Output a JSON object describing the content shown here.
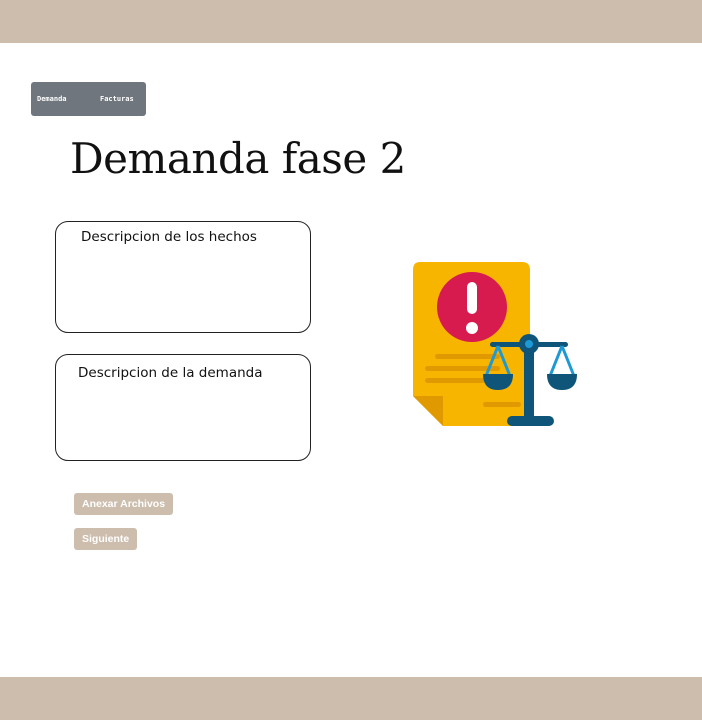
{
  "nav": {
    "demanda_label": "Demanda",
    "facturas_label": "Facturas"
  },
  "page": {
    "title": "Demanda fase 2"
  },
  "form": {
    "hechos_label": "Descripcion de los hechos",
    "demanda_label": "Descripcion de la demanda"
  },
  "actions": {
    "anexar_label": "Anexar Archivos",
    "siguiente_label": "Siguiente"
  },
  "illustration": {
    "icon": "legal-document-scale-icon",
    "colors": {
      "document": "#f7b500",
      "document_fold": "#e09a00",
      "alert_circle": "#d81b4f",
      "scale": "#0f5479",
      "scale_pan": "#1d9ad6"
    }
  },
  "theme": {
    "band_color": "#cdbdad",
    "nav_color": "#6f767d"
  }
}
